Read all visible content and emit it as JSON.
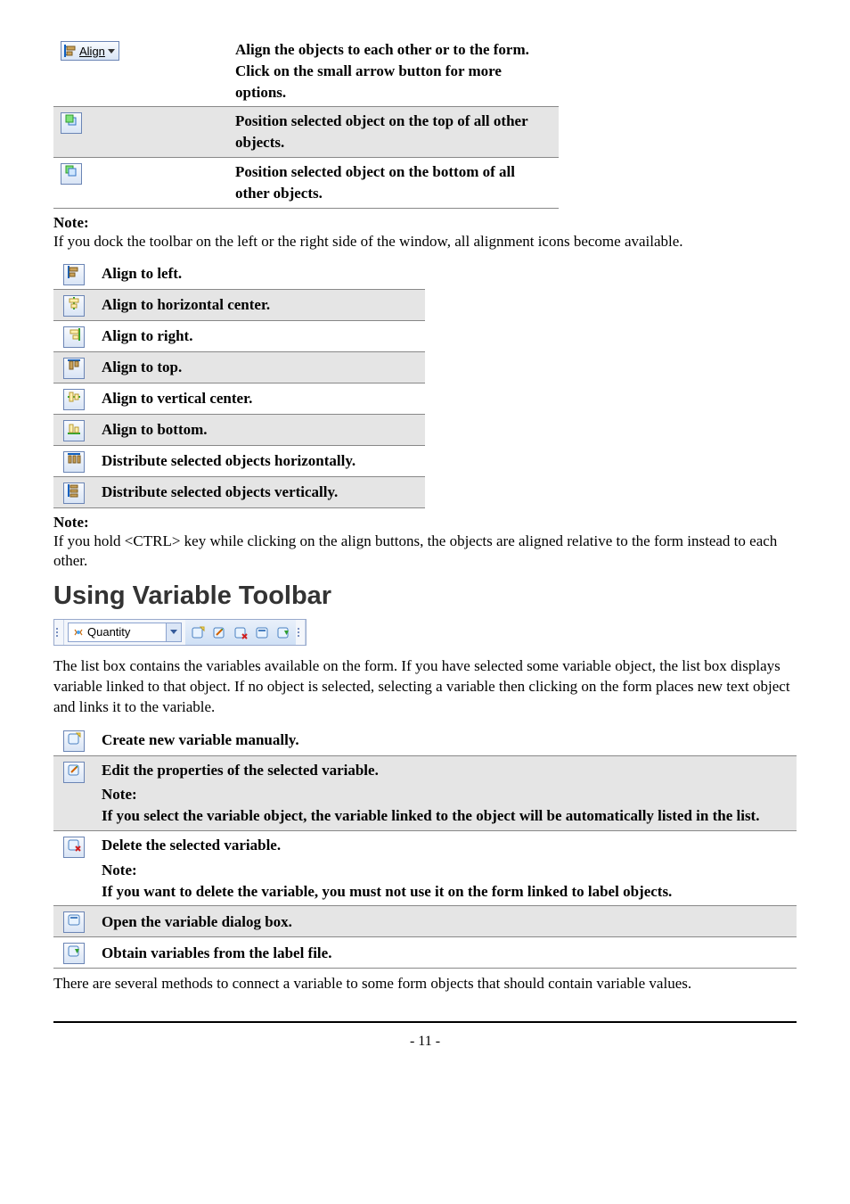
{
  "table1": {
    "rows": [
      {
        "icon": "align-menu-icon",
        "desc": "Align the objects to each other or to the form.\nClick on the small arrow button for more options."
      },
      {
        "icon": "bring-front-icon",
        "desc": "Position selected object on the top of all other objects."
      },
      {
        "icon": "send-back-icon",
        "desc": "Position selected object on the bottom of all other objects."
      }
    ]
  },
  "note1": {
    "heading": "Note:",
    "body": " If you dock the toolbar on the left or the right side of the window, all alignment icons become available."
  },
  "table2": {
    "rows": [
      {
        "icon": "align-left-icon",
        "desc": "Align to left."
      },
      {
        "icon": "align-hcenter-icon",
        "desc": "Align to horizontal center."
      },
      {
        "icon": "align-right-icon",
        "desc": "Align to right."
      },
      {
        "icon": "align-top-icon",
        "desc": "Align to top."
      },
      {
        "icon": "align-vcenter-icon",
        "desc": "Align to vertical center."
      },
      {
        "icon": "align-bottom-icon",
        "desc": "Align to bottom."
      },
      {
        "icon": "distribute-h-icon",
        "desc": "Distribute selected objects horizontally."
      },
      {
        "icon": "distribute-v-icon",
        "desc": "Distribute selected objects vertically."
      }
    ]
  },
  "note2": {
    "heading": "Note:",
    "body": " If you hold <CTRL> key while clicking on the align buttons, the objects are aligned relative to the form instead to each other."
  },
  "heading": "Using Variable Toolbar",
  "variable_toolbar": {
    "combo_label": "Quantity"
  },
  "body_after_toolbar": "The list box contains the variables available on the form. If you have selected some variable object, the list box displays variable linked to that object. If no object is selected, selecting a variable then clicking on the form places new text object and links it to the variable.",
  "table3": {
    "rows": [
      {
        "icon": "var-new-icon",
        "desc": "Create new variable manually."
      },
      {
        "icon": "var-edit-icon",
        "desc": "Edit the properties of the selected variable.",
        "note_heading": "Note:",
        "note_body": " If you select the variable object, the variable linked to the object will be automatically listed in the list."
      },
      {
        "icon": "var-delete-icon",
        "desc": "Delete the selected variable.",
        "note_heading": "Note:",
        "note_body": " If you want to delete the variable, you must not use it on the form linked to label objects."
      },
      {
        "icon": "var-dialog-icon",
        "desc": "Open the variable dialog box."
      },
      {
        "icon": "var-obtain-icon",
        "desc": "Obtain variables from the label file."
      }
    ]
  },
  "body_after_table3": "There are several methods to connect a variable to some form objects that should contain variable values.",
  "page_number": "- 11 -"
}
